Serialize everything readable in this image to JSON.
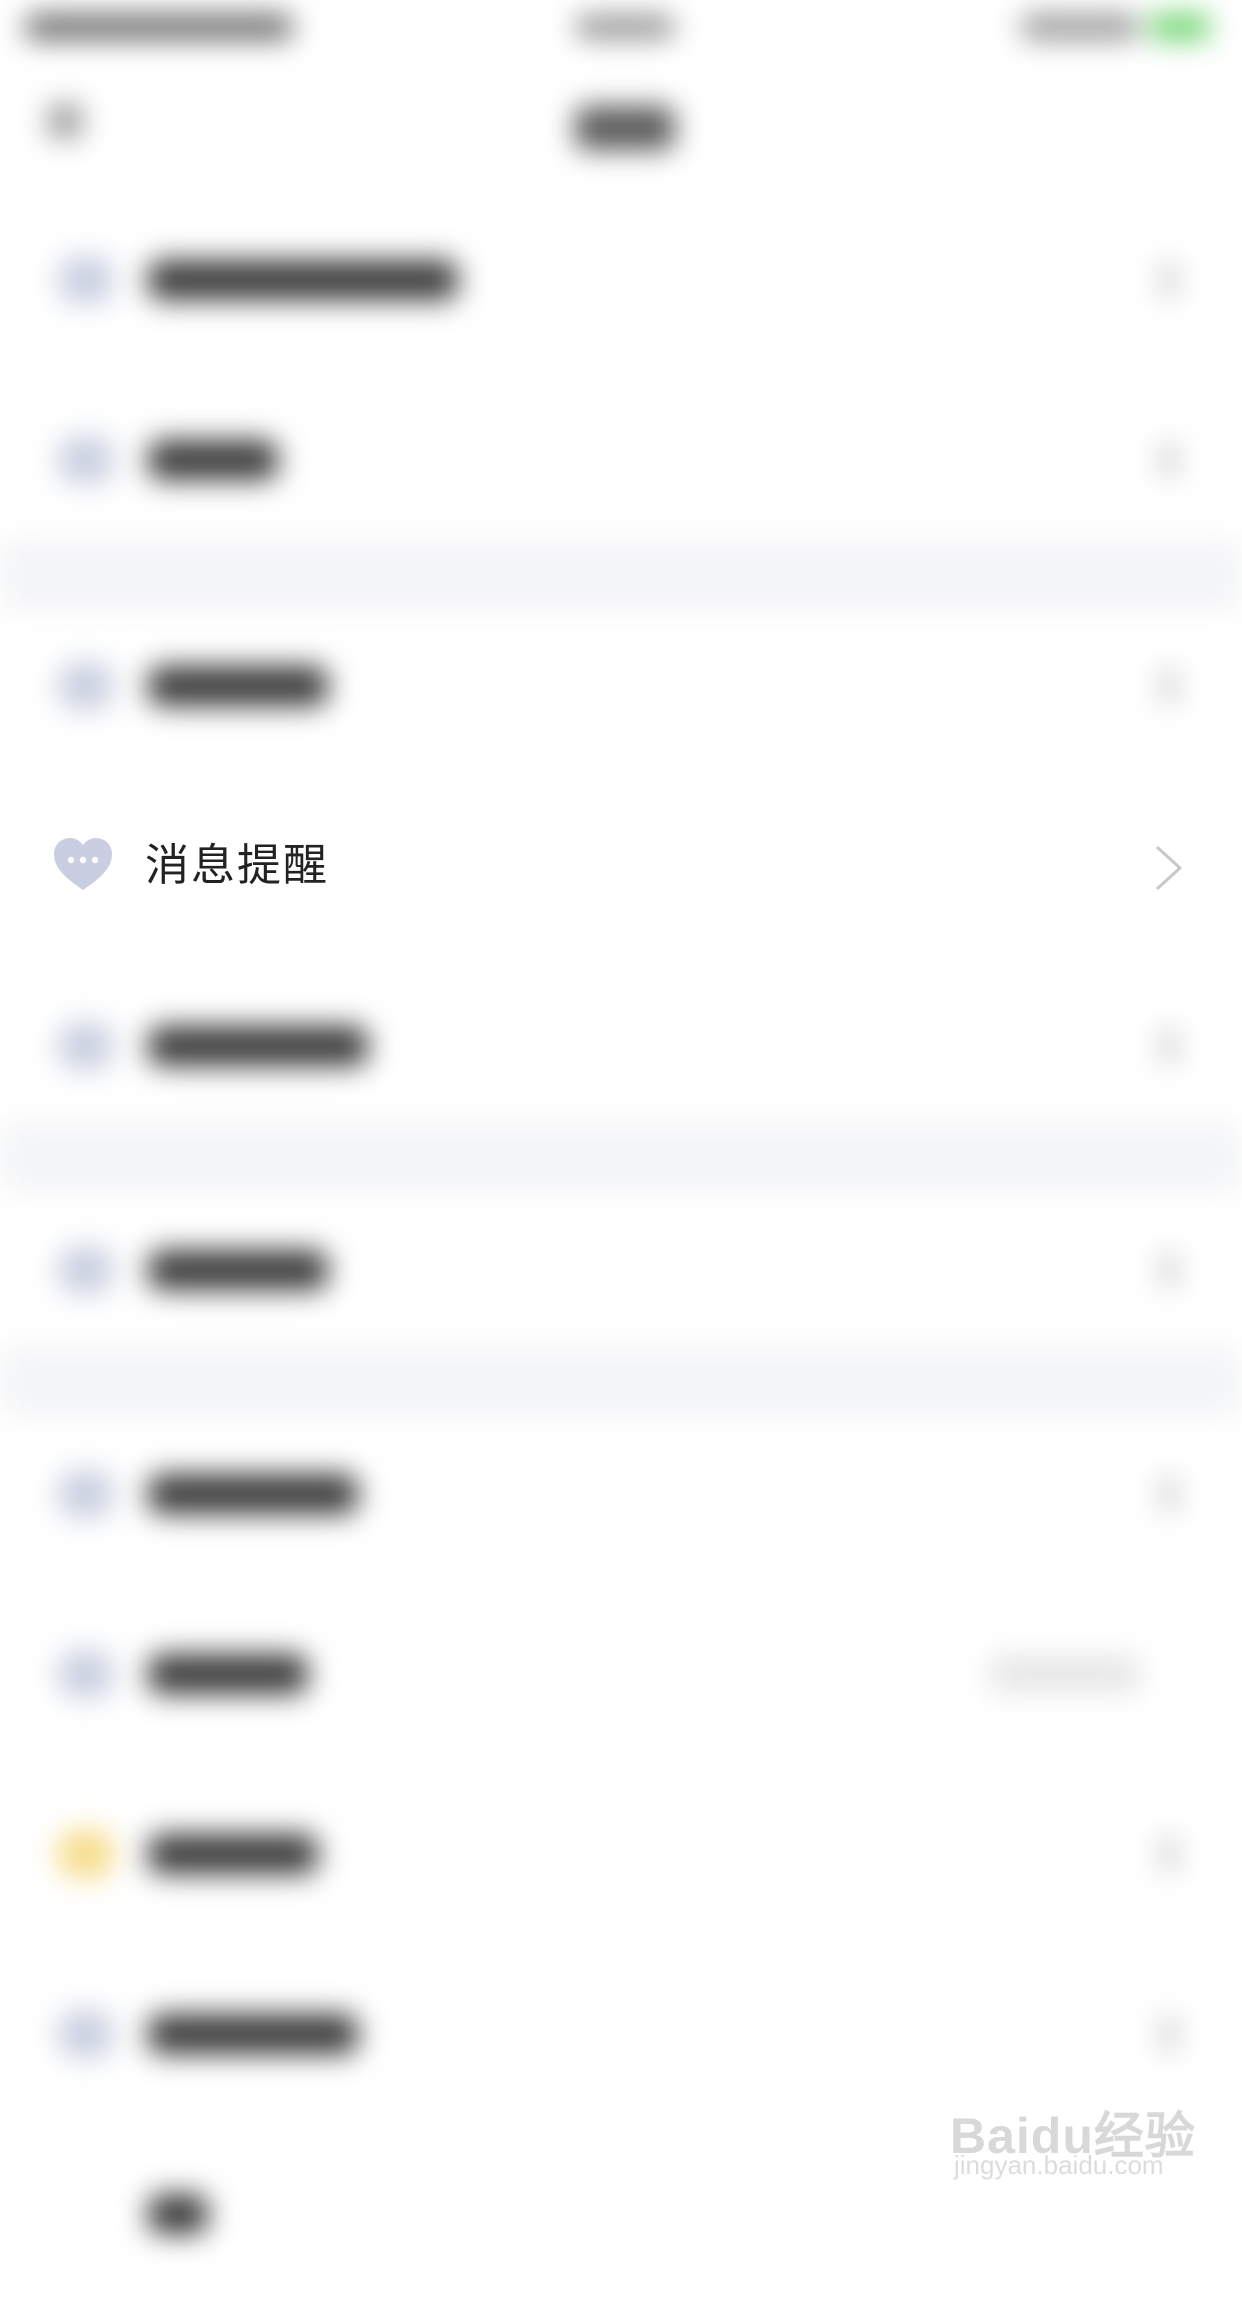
{
  "settings_list": {
    "focused_item": {
      "label": "消息提醒",
      "icon": "heart-chat-icon"
    }
  },
  "watermark": {
    "brand": "Baidu经验",
    "url": "jingyan.baidu.com"
  },
  "colors": {
    "icon_tint": "#c9cfe0",
    "label_text": "#222222",
    "background": "#ffffff",
    "section_separator": "#f4f5f7",
    "chevron": "#c8c8c8"
  }
}
